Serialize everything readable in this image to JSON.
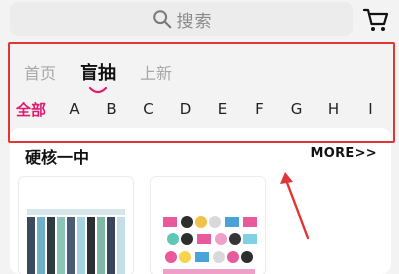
{
  "search": {
    "placeholder": "搜索"
  },
  "tabs": [
    {
      "label": "首页",
      "active": false
    },
    {
      "label": "盲抽",
      "active": true
    },
    {
      "label": "上新",
      "active": false
    }
  ],
  "letters": [
    "全部",
    "A",
    "B",
    "C",
    "D",
    "E",
    "F",
    "G",
    "H",
    "I"
  ],
  "section": {
    "title": "硬核一中",
    "more": "MORE>>"
  },
  "colors": {
    "accent": "#e01b6f",
    "annotation": "#e23636"
  },
  "icons": {
    "search": "search-icon",
    "cart": "cart-icon"
  }
}
